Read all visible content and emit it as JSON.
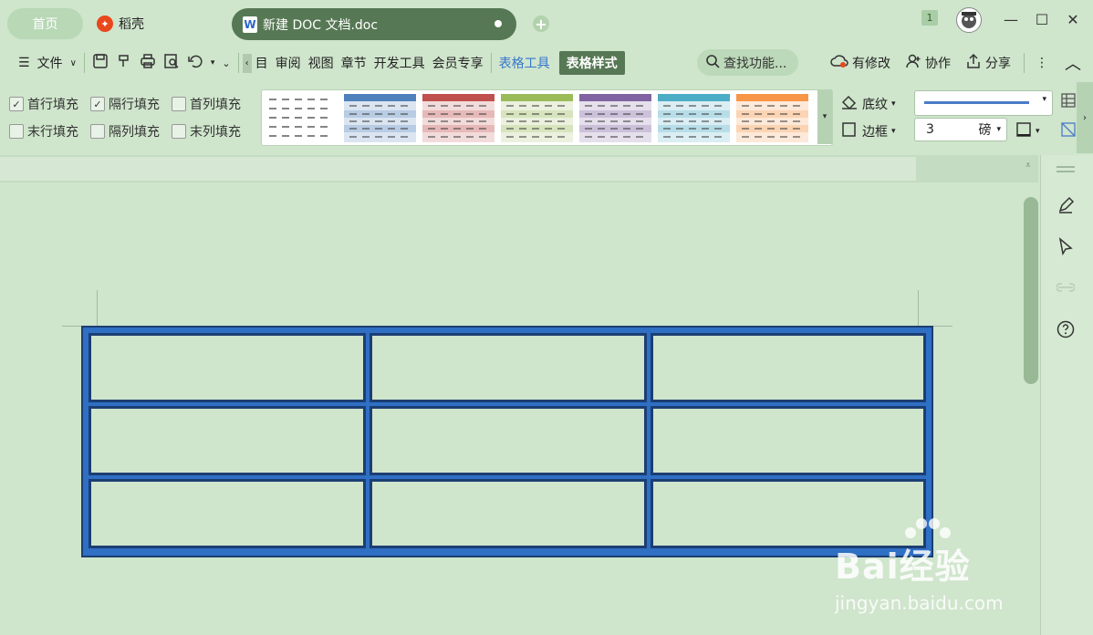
{
  "titlebar": {
    "home_tab": "首页",
    "dao_tab": "稻壳",
    "doc_tab": "新建 DOC 文档.doc",
    "badge_count": "1"
  },
  "toolbar": {
    "file_label": "文件",
    "menu_tabs": [
      "目",
      "审阅",
      "视图",
      "章节",
      "开发工具",
      "会员专享"
    ],
    "table_tools": "表格工具",
    "table_style": "表格样式",
    "search_placeholder": "查找功能...",
    "has_changes": "有修改",
    "collaborate": "协作",
    "share": "分享"
  },
  "ribbon": {
    "checkboxes": [
      {
        "label": "首行填充",
        "checked": true
      },
      {
        "label": "隔行填充",
        "checked": true
      },
      {
        "label": "首列填充",
        "checked": false
      },
      {
        "label": "末行填充",
        "checked": false
      },
      {
        "label": "隔列填充",
        "checked": false
      },
      {
        "label": "末列填充",
        "checked": false
      }
    ],
    "shading_label": "底纹",
    "border_label": "边框",
    "line_width_value": "3",
    "line_width_unit": "磅",
    "style_colors": [
      "#ffffff",
      "#4f81bd",
      "#c0504d",
      "#9bbb59",
      "#8064a2",
      "#4bacc6",
      "#f79646"
    ]
  },
  "watermark": {
    "brand": "Bai经验",
    "url": "jingyan.baidu.com"
  },
  "colors": {
    "accent_green": "#567854",
    "table_blue": "#2f6fc4",
    "table_dark": "#1c3e72",
    "bg": "#cfe5cc"
  }
}
